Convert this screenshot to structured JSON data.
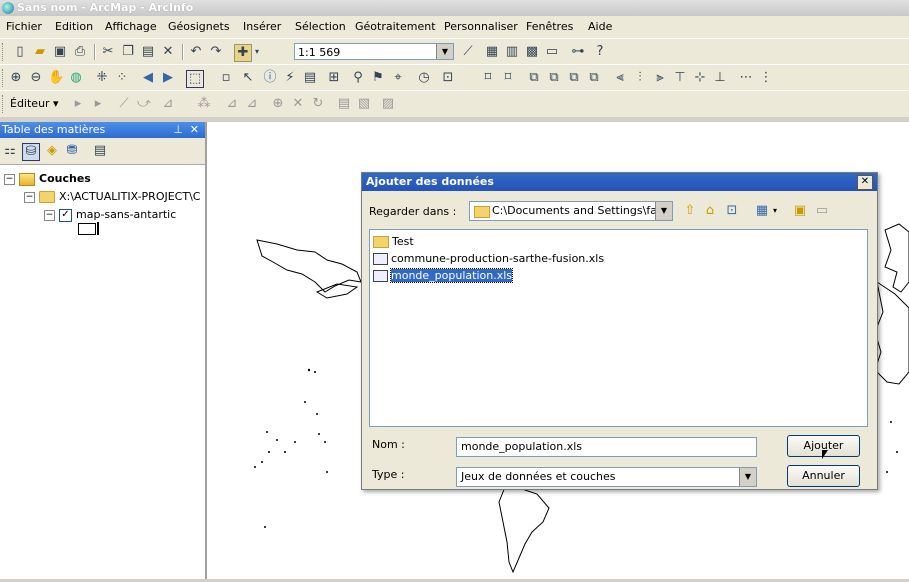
{
  "window": {
    "title": "Sans nom - ArcMap - ArcInfo"
  },
  "menu": [
    "Fichier",
    "Edition",
    "Affichage",
    "Géosignets",
    "Insérer",
    "Sélection",
    "Géotraitement",
    "Personnaliser",
    "Fenêtres",
    "Aide"
  ],
  "toolbar": {
    "scale": "1:1 569",
    "editor_menu": "Éditeur ▾"
  },
  "toc": {
    "title": "Table des matières",
    "root_label": "Couches",
    "folder_label": "X:\\ACTUALITIX-PROJECT\\C",
    "layer_label": "map-sans-antartic"
  },
  "dialog": {
    "title": "Ajouter des données",
    "look_in_label": "Regarder dans :",
    "look_in_value": "C:\\Documents and Settings\\fabi",
    "files": [
      {
        "name": "Test",
        "kind": "folder"
      },
      {
        "name": "commune-production-sarthe-fusion.xls",
        "kind": "xls"
      },
      {
        "name": "monde_population.xls",
        "kind": "xls"
      }
    ],
    "name_label": "Nom :",
    "name_value": "monde_population.xls",
    "type_label": "Type :",
    "type_value": "Jeux de données et couches",
    "add_button": "Ajouter",
    "cancel_button": "Annuler"
  }
}
